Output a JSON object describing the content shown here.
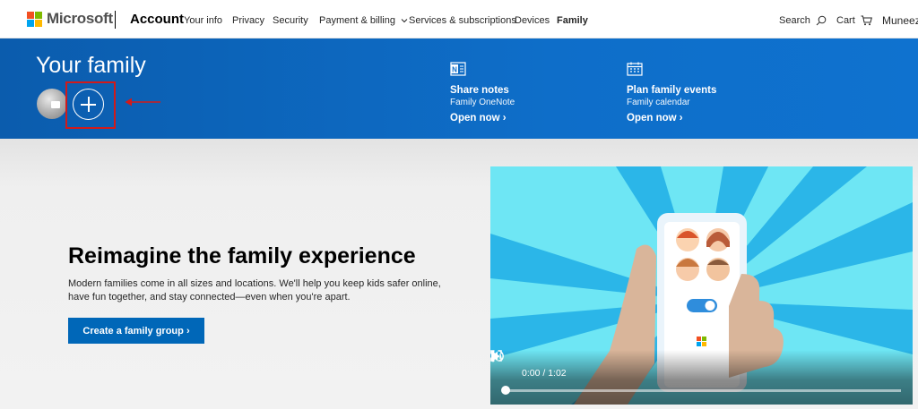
{
  "colors": {
    "ms_red": "#f25022",
    "ms_green": "#7fba00",
    "ms_blue": "#00a4ef",
    "ms_yellow": "#ffb900",
    "banner_blue": "#0e6ec9",
    "cta_blue": "#0067b8",
    "highlight_red": "#d21a1a",
    "video_bg": "#6ee6f4"
  },
  "header": {
    "brand": "Microsoft",
    "section": "Account",
    "nav": [
      {
        "label": "Your info"
      },
      {
        "label": "Privacy"
      },
      {
        "label": "Security"
      },
      {
        "label": "Payment & billing",
        "icon": "chevron-down-icon"
      },
      {
        "label": "Services & subscriptions"
      },
      {
        "label": "Devices"
      },
      {
        "label": "Family",
        "active": true
      }
    ],
    "search_label": "Search",
    "cart_label": "Cart",
    "user_label": "Muneeza"
  },
  "banner": {
    "title": "Your family",
    "avatar_icon": "user-avatar",
    "add_icon": "plus-circle-icon",
    "promos": [
      {
        "icon": "onenote-icon",
        "title": "Share notes",
        "subtitle": "Family OneNote",
        "link": "Open now"
      },
      {
        "icon": "calendar-icon",
        "title": "Plan family events",
        "subtitle": "Family calendar",
        "link": "Open now"
      }
    ]
  },
  "hero": {
    "title": "Reimagine the family experience",
    "text": "Modern families come in all sizes and locations. We'll help you keep kids safer online, have fun together, and stay connected—even when you're apart.",
    "cta_label": "Create a family group"
  },
  "video": {
    "time": "0:00 / 1:02",
    "progress": 0.0,
    "controls": [
      "play-icon",
      "volume-icon",
      "fullscreen-icon",
      "more-icon"
    ]
  }
}
